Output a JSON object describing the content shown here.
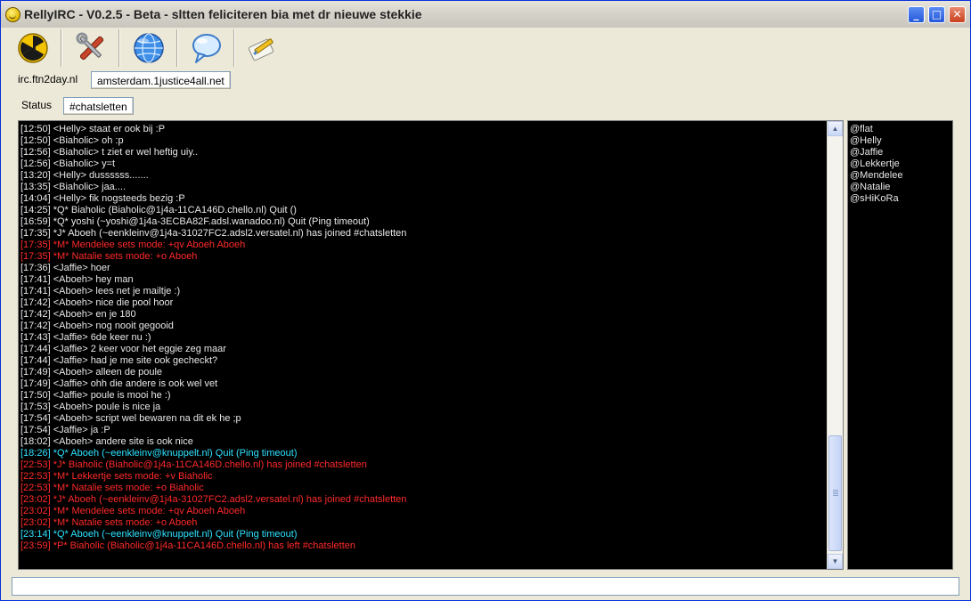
{
  "window": {
    "title": "RellyIRC - V0.2.5 - Beta - sltten feliciteren bia met dr nieuwe stekkie",
    "controls": {
      "minimize": "_",
      "maximize": "□",
      "close": "✕"
    }
  },
  "toolbar": {
    "icons": [
      "radiation-icon",
      "tools-icon",
      "globe-icon",
      "speech-bubble-icon",
      "pen-note-icon"
    ]
  },
  "server_tabs": [
    {
      "label": "irc.ftn2day.nl",
      "active": false
    },
    {
      "label": "amsterdam.1justice4all.net",
      "active": true
    }
  ],
  "channel_tabs": [
    {
      "label": "Status",
      "active": false
    },
    {
      "label": "#chatsletten",
      "active": true
    }
  ],
  "chat": {
    "lines": [
      {
        "text": "[12:50] <Helly> staat er ook bij :P",
        "color": "white"
      },
      {
        "text": "[12:50] <Biaholic> oh :p",
        "color": "white"
      },
      {
        "text": "[12:56] <Biaholic> t ziet er wel heftig uiy..",
        "color": "white"
      },
      {
        "text": "[12:56] <Biaholic> y=t",
        "color": "white"
      },
      {
        "text": "[13:20] <Helly> dussssss.......",
        "color": "white"
      },
      {
        "text": "[13:35] <Biaholic> jaa....",
        "color": "white"
      },
      {
        "text": "[14:04] <Helly> fik nogsteeds bezig :P",
        "color": "white"
      },
      {
        "text": "[14:25] *Q* Biaholic (Biaholic@1j4a-11CA146D.chello.nl) Quit ()",
        "color": "white"
      },
      {
        "text": "[16:59] *Q* yoshi (~yoshi@1j4a-3ECBA82F.adsl.wanadoo.nl) Quit (Ping timeout)",
        "color": "white"
      },
      {
        "text": "[17:35] *J* Aboeh (~eenkleinv@1j4a-31027FC2.adsl2.versatel.nl) has joined #chatsletten",
        "color": "white"
      },
      {
        "text": "[17:35] *M* Mendelee sets mode: +qv Aboeh Aboeh",
        "color": "red"
      },
      {
        "text": "[17:35] *M* Natalie sets mode: +o Aboeh",
        "color": "red"
      },
      {
        "text": "[17:36] <Jaffie> hoer",
        "color": "white"
      },
      {
        "text": "[17:41] <Aboeh> hey man",
        "color": "white"
      },
      {
        "text": "[17:41] <Aboeh> lees net je mailtje :)",
        "color": "white"
      },
      {
        "text": "[17:42] <Aboeh> nice die pool hoor",
        "color": "white"
      },
      {
        "text": "[17:42] <Aboeh> en je 180",
        "color": "white"
      },
      {
        "text": "[17:42] <Aboeh> nog nooit gegooid",
        "color": "white"
      },
      {
        "text": "[17:43] <Jaffie> 6de keer nu :)",
        "color": "white"
      },
      {
        "text": "[17:44] <Jaffie> 2 keer voor het eggie zeg maar",
        "color": "white"
      },
      {
        "text": "[17:44] <Jaffie> had je me site ook gecheckt?",
        "color": "white"
      },
      {
        "text": "[17:49] <Aboeh> alleen de poule",
        "color": "white"
      },
      {
        "text": "[17:49] <Jaffie> ohh die andere is ook wel vet",
        "color": "white"
      },
      {
        "text": "[17:50] <Jaffie> poule is mooi he :)",
        "color": "white"
      },
      {
        "text": "[17:53] <Aboeh> poule is nice ja",
        "color": "white"
      },
      {
        "text": "[17:54] <Aboeh> script wel bewaren na dit ek he ;p",
        "color": "white"
      },
      {
        "text": "[17:54] <Jaffie> ja :P",
        "color": "white"
      },
      {
        "text": "[18:02] <Aboeh> andere site is ook nice",
        "color": "white"
      },
      {
        "text": "[18:26] *Q* Aboeh (~eenkleinv@knuppelt.nl) Quit (Ping timeout)",
        "color": "cyan"
      },
      {
        "text": "[22:53] *J* Biaholic (Biaholic@1j4a-11CA146D.chello.nl) has joined #chatsletten",
        "color": "red"
      },
      {
        "text": "[22:53] *M* Lekkertje sets mode: +v Biaholic",
        "color": "red"
      },
      {
        "text": "[22:53] *M* Natalie sets mode: +o Biaholic",
        "color": "red"
      },
      {
        "text": "[23:02] *J* Aboeh (~eenkleinv@1j4a-31027FC2.adsl2.versatel.nl) has joined #chatsletten",
        "color": "red"
      },
      {
        "text": "[23:02] *M* Mendelee sets mode: +qv Aboeh Aboeh",
        "color": "red"
      },
      {
        "text": "[23:02] *M* Natalie sets mode: +o Aboeh",
        "color": "red"
      },
      {
        "text": "[23:14] *Q* Aboeh (~eenkleinv@knuppelt.nl) Quit (Ping timeout)",
        "color": "cyan"
      },
      {
        "text": "[23:59] *P* Biaholic (Biaholic@1j4a-11CA146D.chello.nl) has left #chatsletten",
        "color": "red"
      }
    ]
  },
  "nicklist": [
    "@flat",
    "@Helly",
    "@Jaffie",
    "@Lekkertje",
    "@Mendelee",
    "@Natalie",
    "@sHiKoRa"
  ],
  "input": {
    "value": "",
    "placeholder": ""
  },
  "colors": {
    "chat_bg": "#000000",
    "text_normal": "#e8e8e8",
    "text_mode": "#ff2a2a",
    "text_quit": "#2fe3ff"
  }
}
